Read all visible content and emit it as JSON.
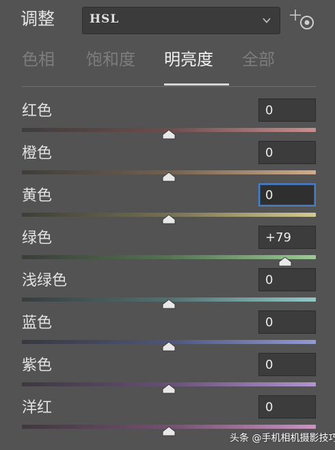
{
  "header": {
    "title": "调整",
    "preset": "HSL",
    "target_tool_icon": "target-adjust-icon"
  },
  "tabs": [
    {
      "label": "色相",
      "active": false
    },
    {
      "label": "饱和度",
      "active": false
    },
    {
      "label": "明亮度",
      "active": true
    },
    {
      "label": "全部",
      "active": false
    }
  ],
  "sliders": [
    {
      "label": "红色",
      "value": "0",
      "position": 0.5,
      "colors": [
        "#3e3d3d",
        "#6e4c4c",
        "#c98f8f"
      ]
    },
    {
      "label": "橙色",
      "value": "0",
      "position": 0.5,
      "colors": [
        "#3e3d3a",
        "#726150",
        "#d0ac8a"
      ]
    },
    {
      "label": "黄色",
      "value": "0",
      "position": 0.5,
      "colors": [
        "#3e3e38",
        "#747052",
        "#d4cb92"
      ],
      "focused": true
    },
    {
      "label": "绿色",
      "value": "+79",
      "position": 0.895,
      "colors": [
        "#393e39",
        "#547352",
        "#9acb92"
      ]
    },
    {
      "label": "浅绿色",
      "value": "0",
      "position": 0.5,
      "colors": [
        "#383e3e",
        "#527070",
        "#93c8c7"
      ]
    },
    {
      "label": "蓝色",
      "value": "0",
      "position": 0.5,
      "colors": [
        "#38393f",
        "#4f5578",
        "#939ad2"
      ]
    },
    {
      "label": "紫色",
      "value": "0",
      "position": 0.5,
      "colors": [
        "#3c383f",
        "#665077",
        "#b294cf"
      ]
    },
    {
      "label": "洋红",
      "value": "0",
      "position": 0.5,
      "colors": [
        "#3f383d",
        "#745070",
        "#cc93c2"
      ]
    }
  ],
  "watermark": "头条 @手机相机摄影技巧"
}
